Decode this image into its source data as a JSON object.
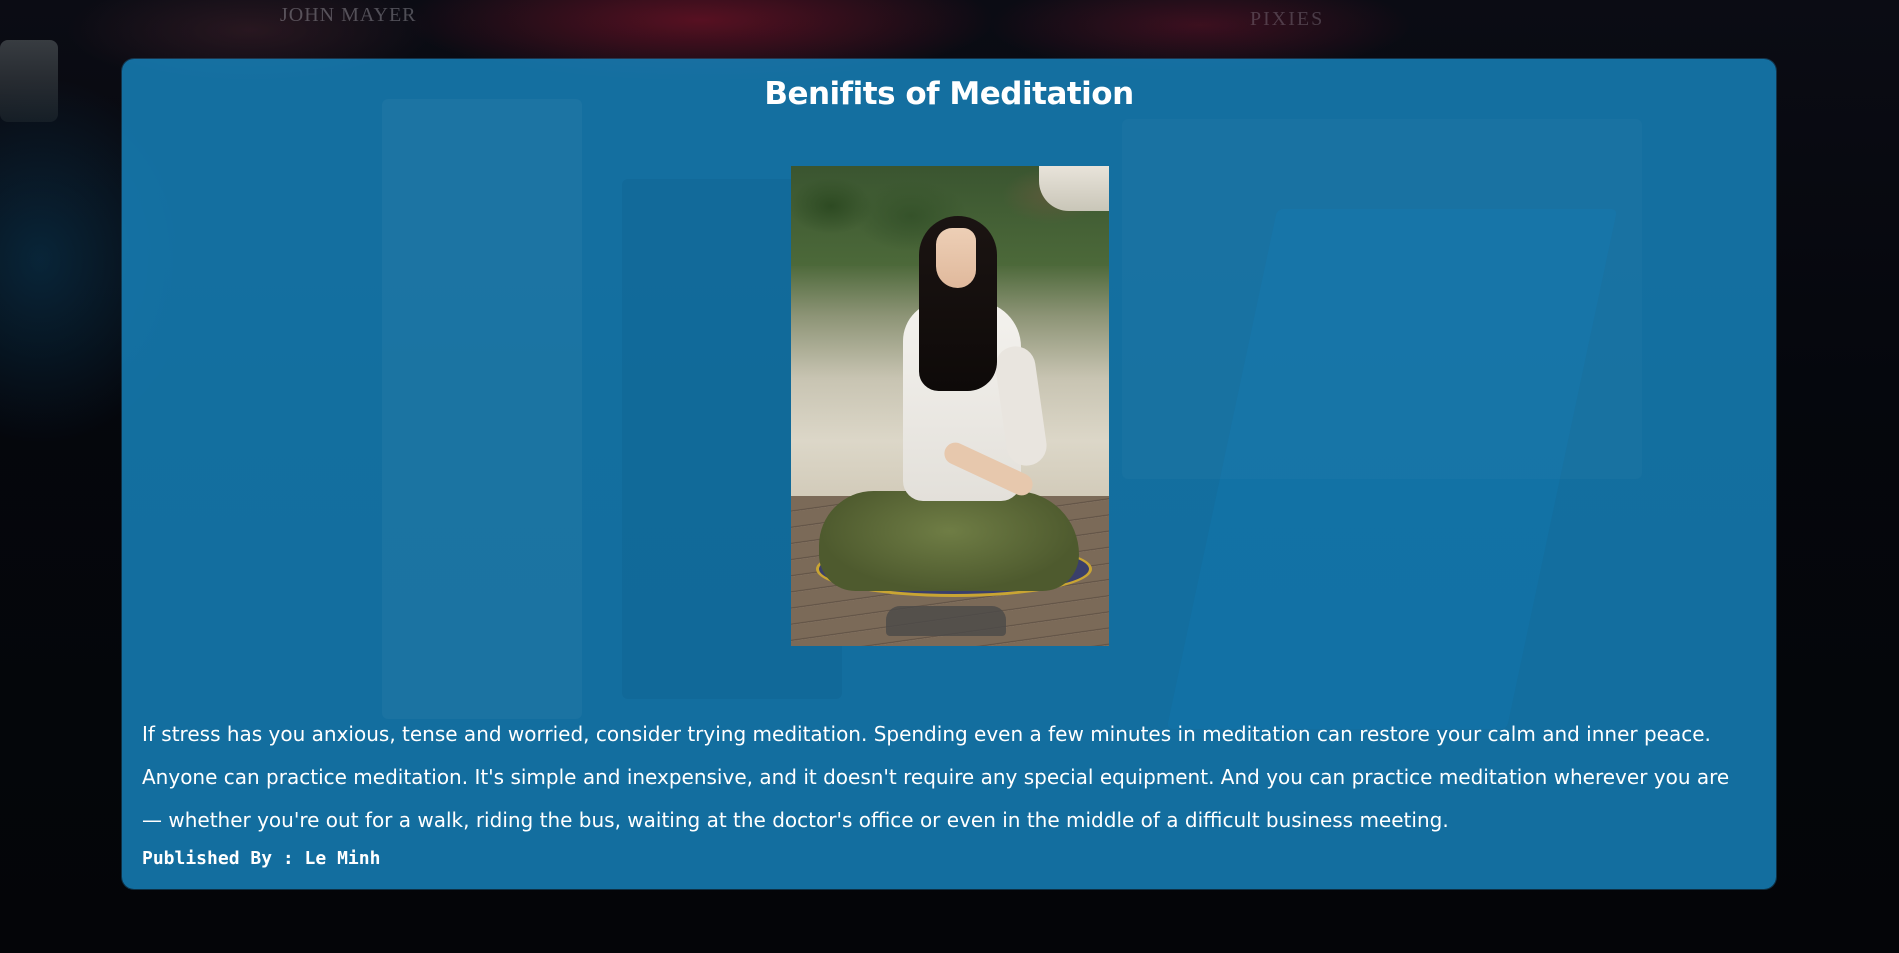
{
  "article": {
    "title": "Benifits of Meditation",
    "image_alt": "Woman meditating cross-legged on a wooden dock by a lake",
    "body": "If stress has you anxious, tense and worried, consider trying meditation. Spending even a few minutes in meditation can restore your calm and inner peace. Anyone can practice meditation. It's simple and inexpensive, and it doesn't require any special equipment. And you can practice meditation wherever you are — whether you're out for a walk, riding the bus, waiting at the doctor's office or even in the middle of a difficult business meeting.",
    "byline": "Published By : Le Minh"
  },
  "background": {
    "text_left": "JOHN MAYER",
    "text_right": "PIXIES"
  },
  "colors": {
    "panel": "#1680b8",
    "text": "#ffffff",
    "page_background": "#05070d"
  }
}
